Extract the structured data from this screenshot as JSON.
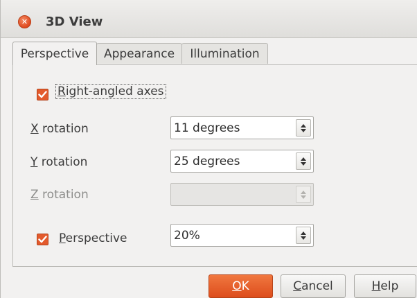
{
  "window": {
    "title": "3D View"
  },
  "tabs": [
    {
      "label": "Perspective",
      "active": true
    },
    {
      "label": "Appearance",
      "active": false
    },
    {
      "label": "Illumination",
      "active": false
    }
  ],
  "right_angled": {
    "mnemonic": "R",
    "label_rest": "ight-angled axes",
    "checked": true
  },
  "x_rotation": {
    "mnemonic": "X",
    "label_rest": " rotation",
    "value": "11 degrees"
  },
  "y_rotation": {
    "mnemonic": "Y",
    "label_rest": " rotation",
    "value": "25 degrees"
  },
  "z_rotation": {
    "mnemonic": "Z",
    "label_rest": " rotation",
    "value": "",
    "disabled": true
  },
  "perspective": {
    "mnemonic": "P",
    "label_rest": "erspective",
    "checked": true,
    "value": "20%"
  },
  "buttons": {
    "ok_mnemonic": "O",
    "ok_rest": "K",
    "cancel_mnemonic": "C",
    "cancel_rest": "ancel",
    "help_mnemonic": "H",
    "help_rest": "elp"
  },
  "colors": {
    "accent": "#e35a2c",
    "background": "#f2f1f0"
  }
}
